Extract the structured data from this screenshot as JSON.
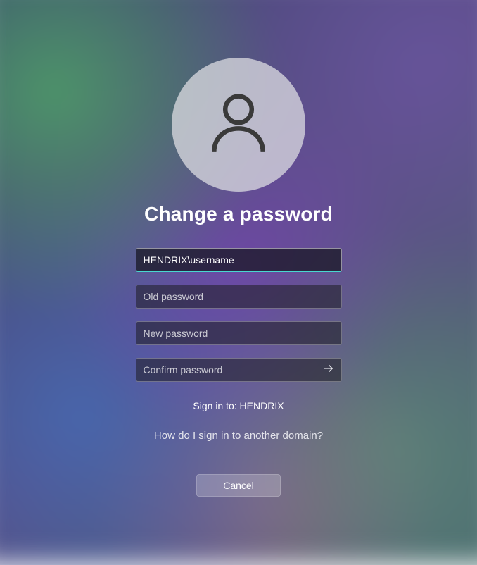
{
  "title": "Change a password",
  "form": {
    "username_value": "HENDRIX\\username",
    "old_password_placeholder": "Old password",
    "new_password_placeholder": "New password",
    "confirm_password_placeholder": "Confirm password"
  },
  "signin_text": "Sign in to: HENDRIX",
  "domain_link": "How do I sign in to another domain?",
  "cancel_label": "Cancel"
}
